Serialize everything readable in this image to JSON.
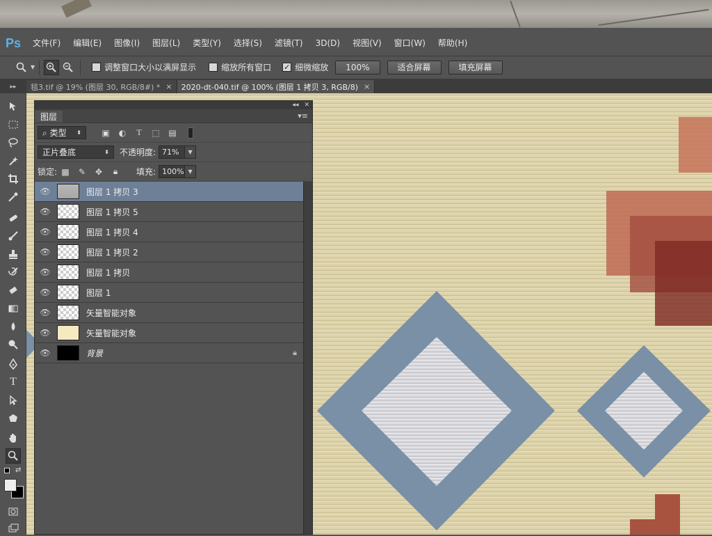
{
  "app": {
    "logo": "Ps"
  },
  "menu": [
    "文件(F)",
    "编辑(E)",
    "图像(I)",
    "图层(L)",
    "类型(Y)",
    "选择(S)",
    "滤镜(T)",
    "3D(D)",
    "视图(V)",
    "窗口(W)",
    "帮助(H)"
  ],
  "options": {
    "resize_windows": "调整窗口大小以满屏显示",
    "zoom_all": "缩放所有窗口",
    "scrubby_zoom": "细微缩放",
    "zoom_100": "100%",
    "fit_screen": "适合屏幕",
    "fill_screen": "填充屏幕"
  },
  "tabs": [
    {
      "title": "毯3.tif @ 19% (图层 30, RGB/8#) *",
      "active": false
    },
    {
      "title": "2020-dt-040.tif @ 100% (图层 1 拷贝 3, RGB/8)",
      "active": true
    }
  ],
  "layers_panel": {
    "title": "图层",
    "filter_kind": "类型",
    "blend_mode": "正片叠底",
    "opacity_label": "不透明度:",
    "opacity": "71%",
    "lock_label": "锁定:",
    "fill_label": "填充:",
    "fill": "100%",
    "layers": [
      {
        "name": "图层 1 拷贝 3",
        "thumb": "gray",
        "selected": true
      },
      {
        "name": "图层 1 拷贝 5",
        "thumb": "checker"
      },
      {
        "name": "图层 1 拷贝 4",
        "thumb": "checker"
      },
      {
        "name": "图层 1 拷贝 2",
        "thumb": "checker"
      },
      {
        "name": "图层 1 拷贝",
        "thumb": "checker"
      },
      {
        "name": "图层 1",
        "thumb": "checker"
      },
      {
        "name": "矢量智能对象",
        "thumb": "checker"
      },
      {
        "name": "矢量智能对象",
        "thumb": "cream"
      },
      {
        "name": "背景",
        "thumb": "black",
        "locked": true
      }
    ]
  },
  "colors": {
    "accent": "#6e8098",
    "diamond": "#7990a6",
    "wood": "#d9cfa6",
    "rust": "#a8533f"
  }
}
